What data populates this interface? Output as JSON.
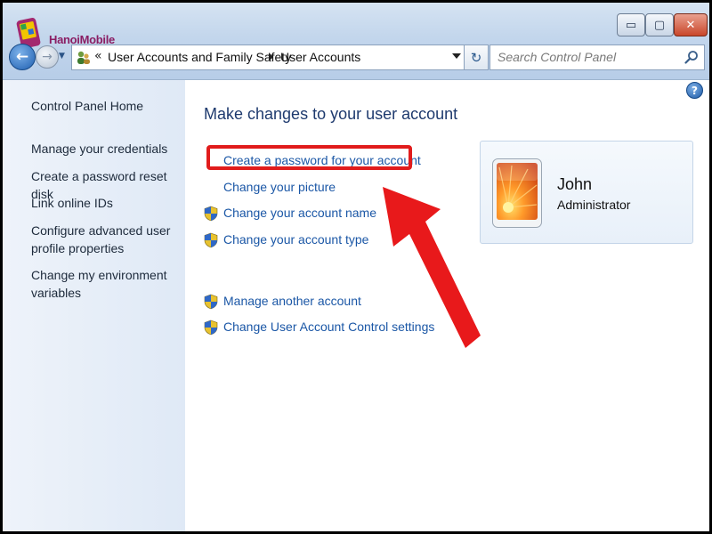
{
  "window": {
    "minimize_label": "▭",
    "maximize_label": "▢",
    "close_label": "✕"
  },
  "watermark": "HanoiMobile",
  "address_bar": {
    "chevrons": "«",
    "breadcrumbs": [
      "User Accounts and Family Safety",
      "User Accounts"
    ]
  },
  "search": {
    "placeholder": "Search Control Panel"
  },
  "left_pane": {
    "items": [
      "Control Panel Home",
      "Manage your credentials",
      "Create a password reset disk",
      "Link online IDs",
      "Configure advanced user profile properties",
      "Change my environment variables"
    ]
  },
  "main": {
    "heading": "Make changes to your user account",
    "tasks": [
      {
        "label": "Create a password for your account",
        "icon": "none",
        "highlighted": true
      },
      {
        "label": "Change your picture",
        "icon": "none"
      },
      {
        "label": "Change your account name",
        "icon": "uac-shield-icon"
      },
      {
        "label": "Change your account type",
        "icon": "uac-shield-icon"
      },
      {
        "label": "Manage another account",
        "icon": "uac-shield-icon"
      },
      {
        "label": "Change User Account Control settings",
        "icon": "uac-shield-icon"
      }
    ]
  },
  "user": {
    "name": "John",
    "role": "Administrator"
  },
  "colors": {
    "link": "#1b57a6",
    "heading": "#1e3a6e",
    "highlight": "#e11c1c",
    "arrow": "#e8191b"
  }
}
